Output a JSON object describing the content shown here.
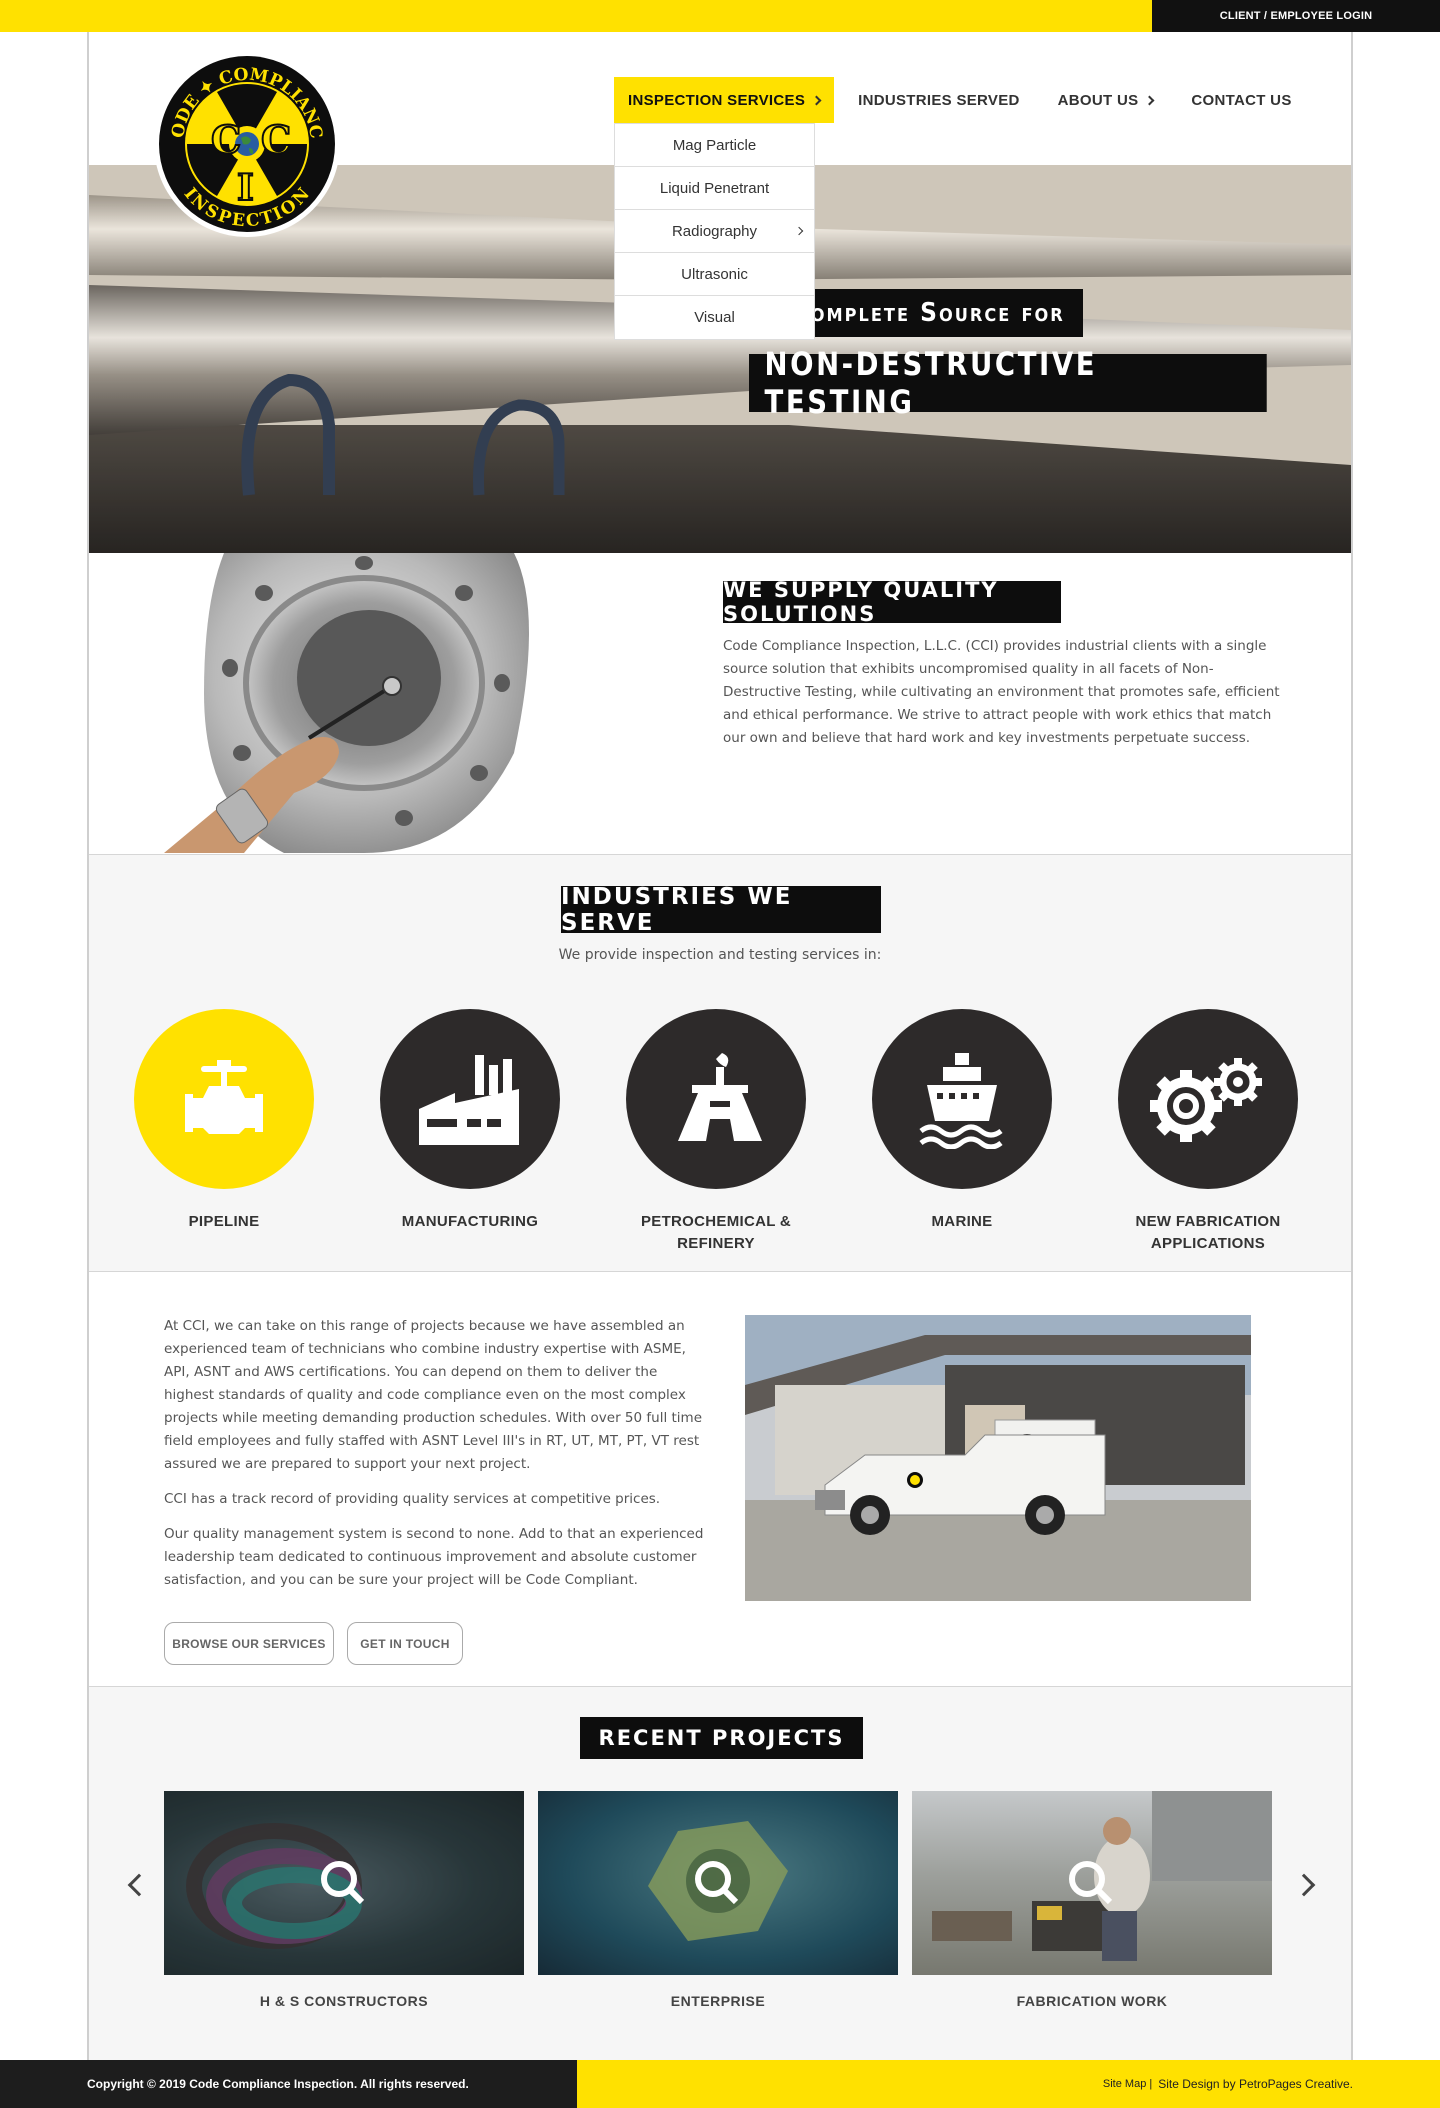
{
  "topbar": {
    "login_label": "CLIENT / EMPLOYEE LOGIN"
  },
  "logo": {
    "text_top": "CODE COMPLIANCE",
    "text_bottom": "INSPECTION",
    "letters": [
      "C",
      "C",
      "I"
    ]
  },
  "nav": {
    "items": [
      {
        "label": "INSPECTION SERVICES",
        "active": true,
        "has_submenu": true
      },
      {
        "label": "INDUSTRIES SERVED",
        "active": false,
        "has_submenu": false
      },
      {
        "label": "ABOUT US",
        "active": false,
        "has_submenu": true
      },
      {
        "label": "CONTACT US",
        "active": false,
        "has_submenu": false
      }
    ],
    "dropdown": [
      "Mag Particle",
      "Liquid Penetrant",
      "Radiography",
      "Ultrasonic",
      "Visual"
    ]
  },
  "hero": {
    "line1": "r Complete Source for",
    "line2": "NON-DESTRUCTIVE TESTING"
  },
  "quality": {
    "heading": "WE SUPPLY QUALITY SOLUTIONS",
    "body": "Code Compliance Inspection, L.L.C. (CCI) provides industrial clients with a single source solution that exhibits uncompromised quality in all facets of Non-Destructive Testing, while cultivating an environment that promotes safe, efficient and ethical performance. We strive to attract people with work ethics that match our own and believe that hard work and key investments perpetuate success."
  },
  "industries": {
    "heading": "INDUSTRIES WE SERVE",
    "subtitle": "We provide inspection and testing services in:",
    "items": [
      {
        "label": "PIPELINE",
        "icon": "valve-icon"
      },
      {
        "label": "MANUFACTURING",
        "icon": "factory-icon"
      },
      {
        "label": "PETROCHEMICAL & REFINERY",
        "icon": "refinery-icon"
      },
      {
        "label": "MARINE",
        "icon": "ship-icon"
      },
      {
        "label": "NEW FABRICATION APPLICATIONS",
        "icon": "gears-icon"
      }
    ]
  },
  "about": {
    "p1": "At CCI, we can take on this range of projects because we have assembled an experienced team of technicians who combine industry expertise with ASME, API, ASNT and AWS certifications. You can depend on them to deliver the highest standards of quality and code compliance even on the most complex projects while meeting demanding production schedules. With over 50 full time field employees and fully staffed with ASNT Level III's in RT, UT, MT, PT, VT rest assured we are prepared to support your next project.",
    "p2": "CCI has a track record of providing quality services at competitive prices.",
    "p3": "Our quality management system is second to none. Add to that an experienced leadership team dedicated to continuous improvement and absolute customer satisfaction, and you can be sure your project will be Code Compliant.",
    "btn_services": "BROWSE OUR SERVICES",
    "btn_touch": "GET IN TOUCH"
  },
  "projects": {
    "heading": "RECENT PROJECTS",
    "items": [
      "H & S CONSTRUCTORS",
      "ENTERPRISE",
      "FABRICATION WORK"
    ]
  },
  "footer": {
    "copyright": "Copyright © 2019 Code Compliance Inspection. All rights reserved.",
    "sitemap": "Site Map |",
    "design": "Site Design by PetroPages Creative."
  },
  "colors": {
    "accent": "#ffe100",
    "dark": "#2d2a2a"
  }
}
